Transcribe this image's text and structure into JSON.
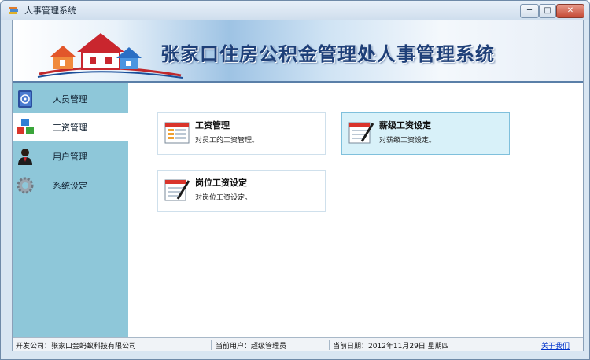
{
  "window": {
    "title": "人事管理系统",
    "minimize": "─",
    "maximize": "□",
    "close": "✕"
  },
  "banner": {
    "title": "张家口住房公积金管理处人事管理系统"
  },
  "sidebar": {
    "items": [
      {
        "label": "人员管理",
        "icon": "person-book-icon"
      },
      {
        "label": "工资管理",
        "icon": "blocks-icon"
      },
      {
        "label": "用户管理",
        "icon": "user-icon"
      },
      {
        "label": "系统设定",
        "icon": "gear-icon"
      }
    ],
    "active_index": 1
  },
  "main": {
    "cards": [
      {
        "title": "工资管理",
        "desc": "对员工的工资管理。",
        "icon": "spreadsheet-icon"
      },
      {
        "title": "薪级工资设定",
        "desc": "对薪级工资设定。",
        "icon": "spreadsheet-pen-icon",
        "selected": true
      },
      {
        "title": "岗位工资设定",
        "desc": "对岗位工资设定。",
        "icon": "spreadsheet-pen-icon"
      }
    ]
  },
  "status": {
    "company": "开发公司：张家口金蚂蚁科技有限公司",
    "user": "当前用户：超级管理员",
    "date": "当前日期：2012年11月29日 星期四",
    "about": "关于我们"
  },
  "colors": {
    "sidebar": "#8ec7d9",
    "selected_card": "#d8f1f9",
    "banner_text": "#1e3f78"
  }
}
